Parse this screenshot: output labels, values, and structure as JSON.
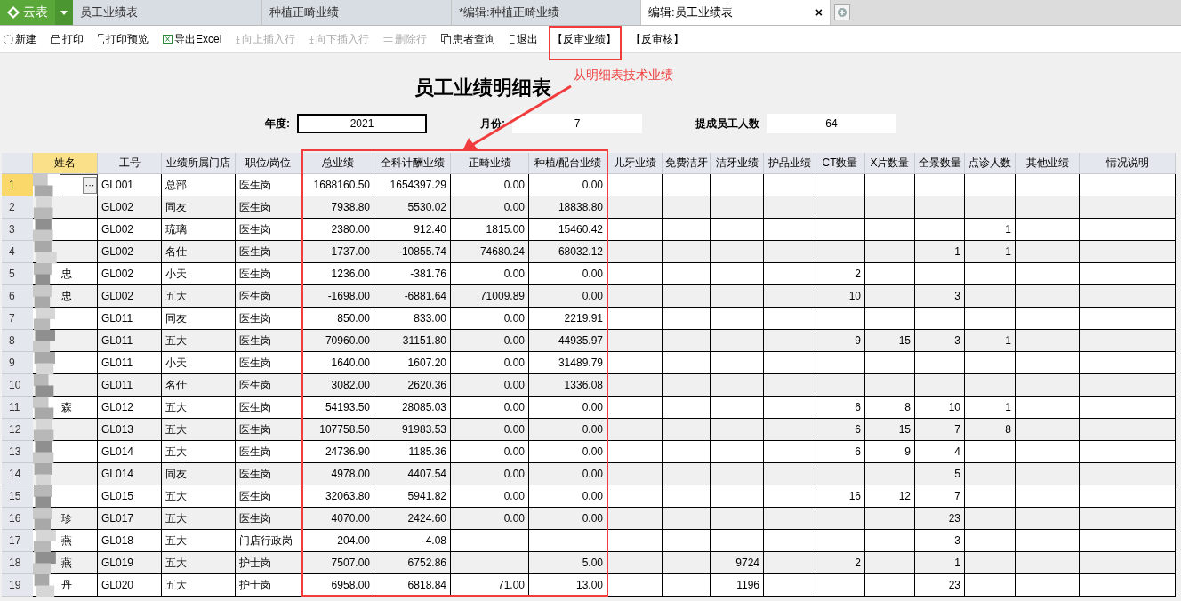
{
  "app": {
    "logo": "云表"
  },
  "tabs": [
    {
      "label": "员工业绩表",
      "selected": false
    },
    {
      "label": "种植正畸业绩",
      "selected": false
    },
    {
      "label": "*编辑:种植正畸业绩",
      "selected": false
    },
    {
      "label": "编辑:员工业绩表",
      "selected": true,
      "close": "×"
    }
  ],
  "toolbar": [
    {
      "label": "新建",
      "disabled": false
    },
    {
      "label": "打印",
      "disabled": false
    },
    {
      "label": "打印预览",
      "disabled": false
    },
    {
      "label": "导出Excel",
      "disabled": false
    },
    {
      "label": "向上插入行",
      "disabled": true
    },
    {
      "label": "向下插入行",
      "disabled": true
    },
    {
      "label": "删除行",
      "disabled": true
    },
    {
      "label": "患者查询",
      "disabled": false
    },
    {
      "label": "退出",
      "disabled": false
    },
    {
      "label": "【反审业绩】",
      "disabled": false
    },
    {
      "label": "【反审核】",
      "disabled": false
    }
  ],
  "report": {
    "title": "员工业绩明细表",
    "fields": [
      {
        "label": "年度:",
        "value": "2021",
        "focused": true
      },
      {
        "label": "月份:",
        "value": "7",
        "focused": false
      },
      {
        "label": "提成员工人数",
        "value": "64",
        "focused": false
      }
    ]
  },
  "table": {
    "columns": [
      "姓名",
      "工号",
      "业绩所属门店",
      "职位/岗位",
      "总业绩",
      "全科计酬业绩",
      "正畸业绩",
      "种植/配台业绩",
      "儿牙业绩",
      "免费洁牙",
      "洁牙业绩",
      "护品业绩",
      "CT数量",
      "X片数量",
      "全景数量",
      "点诊人数",
      "其他业绩",
      "情况说明"
    ],
    "rows": [
      {
        "index": "1",
        "selected": true,
        "action": "···",
        "cells": [
          null,
          "GL001",
          "总部",
          "医生岗",
          "1688160.50",
          "1654397.29",
          "0.00",
          "0.00",
          null,
          null,
          null,
          null,
          null,
          null,
          null,
          null,
          null,
          null
        ]
      },
      {
        "index": "2",
        "selected": false,
        "cells": [
          null,
          "GL002",
          "同友",
          "医生岗",
          "7938.80",
          "5530.02",
          "0.00",
          "18838.80",
          null,
          null,
          null,
          null,
          null,
          null,
          null,
          null,
          null,
          null
        ]
      },
      {
        "index": "3",
        "selected": false,
        "cells": [
          null,
          "GL002",
          "琉璃",
          "医生岗",
          "2380.00",
          "912.40",
          "1815.00",
          "15460.42",
          null,
          null,
          null,
          null,
          null,
          null,
          null,
          "1",
          null,
          null
        ]
      },
      {
        "index": "4",
        "selected": false,
        "cells": [
          null,
          "GL002",
          "名仕",
          "医生岗",
          "1737.00",
          "-10855.74",
          "74680.24",
          "68032.12",
          null,
          null,
          null,
          null,
          null,
          null,
          "1",
          "1",
          null,
          null
        ]
      },
      {
        "index": "5",
        "selected": false,
        "cells": [
          "忠",
          "GL002",
          "小天",
          "医生岗",
          "1236.00",
          "-381.76",
          "0.00",
          "0.00",
          null,
          null,
          null,
          null,
          "2",
          null,
          null,
          null,
          null,
          null
        ]
      },
      {
        "index": "6",
        "selected": false,
        "cells": [
          "忠",
          "GL002",
          "五大",
          "医生岗",
          "-1698.00",
          "-6881.64",
          "71009.89",
          "0.00",
          null,
          null,
          null,
          null,
          "10",
          null,
          "3",
          null,
          null,
          null
        ]
      },
      {
        "index": "7",
        "selected": false,
        "cells": [
          null,
          "GL011",
          "同友",
          "医生岗",
          "850.00",
          "833.00",
          "0.00",
          "2219.91",
          null,
          null,
          null,
          null,
          null,
          null,
          null,
          null,
          null,
          null
        ]
      },
      {
        "index": "8",
        "selected": false,
        "cells": [
          null,
          "GL011",
          "五大",
          "医生岗",
          "70960.00",
          "31151.80",
          "0.00",
          "44935.97",
          null,
          null,
          null,
          null,
          "9",
          "15",
          "3",
          "1",
          null,
          null
        ]
      },
      {
        "index": "9",
        "selected": false,
        "cells": [
          null,
          "GL011",
          "小天",
          "医生岗",
          "1640.00",
          "1607.20",
          "0.00",
          "31489.79",
          null,
          null,
          null,
          null,
          null,
          null,
          null,
          null,
          null,
          null
        ]
      },
      {
        "index": "10",
        "selected": false,
        "cells": [
          null,
          "GL011",
          "名仕",
          "医生岗",
          "3082.00",
          "2620.36",
          "0.00",
          "1336.08",
          null,
          null,
          null,
          null,
          null,
          null,
          null,
          null,
          null,
          null
        ]
      },
      {
        "index": "11",
        "selected": false,
        "cells": [
          "森",
          "GL012",
          "五大",
          "医生岗",
          "54193.50",
          "28085.03",
          "0.00",
          "0.00",
          null,
          null,
          null,
          null,
          "6",
          "8",
          "10",
          "1",
          null,
          null
        ]
      },
      {
        "index": "12",
        "selected": false,
        "cells": [
          null,
          "GL013",
          "五大",
          "医生岗",
          "107758.50",
          "91983.53",
          "0.00",
          "0.00",
          null,
          null,
          null,
          null,
          "6",
          "15",
          "7",
          "8",
          null,
          null
        ]
      },
      {
        "index": "13",
        "selected": false,
        "cells": [
          null,
          "GL014",
          "五大",
          "医生岗",
          "24736.90",
          "1185.36",
          "0.00",
          "0.00",
          null,
          null,
          null,
          null,
          "6",
          "9",
          "4",
          null,
          null,
          null
        ]
      },
      {
        "index": "14",
        "selected": false,
        "cells": [
          null,
          "GL014",
          "同友",
          "医生岗",
          "4978.00",
          "4407.54",
          "0.00",
          "0.00",
          null,
          null,
          null,
          null,
          null,
          null,
          "5",
          null,
          null,
          null
        ]
      },
      {
        "index": "15",
        "selected": false,
        "cells": [
          null,
          "GL015",
          "五大",
          "医生岗",
          "32063.80",
          "5941.82",
          "0.00",
          "0.00",
          null,
          null,
          null,
          null,
          "16",
          "12",
          "7",
          null,
          null,
          null
        ]
      },
      {
        "index": "16",
        "selected": false,
        "cells": [
          "珍",
          "GL017",
          "五大",
          "医生岗",
          "4070.00",
          "2424.60",
          "0.00",
          "0.00",
          null,
          null,
          null,
          null,
          null,
          null,
          "23",
          null,
          null,
          null
        ]
      },
      {
        "index": "17",
        "selected": false,
        "cells": [
          "燕",
          "GL018",
          "五大",
          "门店行政岗",
          "204.00",
          "-4.08",
          null,
          null,
          null,
          null,
          null,
          null,
          null,
          null,
          "3",
          null,
          null,
          null
        ]
      },
      {
        "index": "18",
        "selected": false,
        "cells": [
          "燕",
          "GL019",
          "五大",
          "护士岗",
          "7507.00",
          "6752.86",
          null,
          "5.00",
          null,
          null,
          "9724",
          null,
          "2",
          null,
          "1",
          null,
          null,
          null
        ]
      },
      {
        "index": "19",
        "selected": false,
        "cells": [
          "丹",
          "GL020",
          "五大",
          "护士岗",
          "6958.00",
          "6818.84",
          "71.00",
          "13.00",
          null,
          null,
          "1196",
          null,
          null,
          null,
          "23",
          null,
          null,
          null
        ]
      }
    ]
  },
  "annotation": {
    "text": "从明细表技术业绩"
  }
}
